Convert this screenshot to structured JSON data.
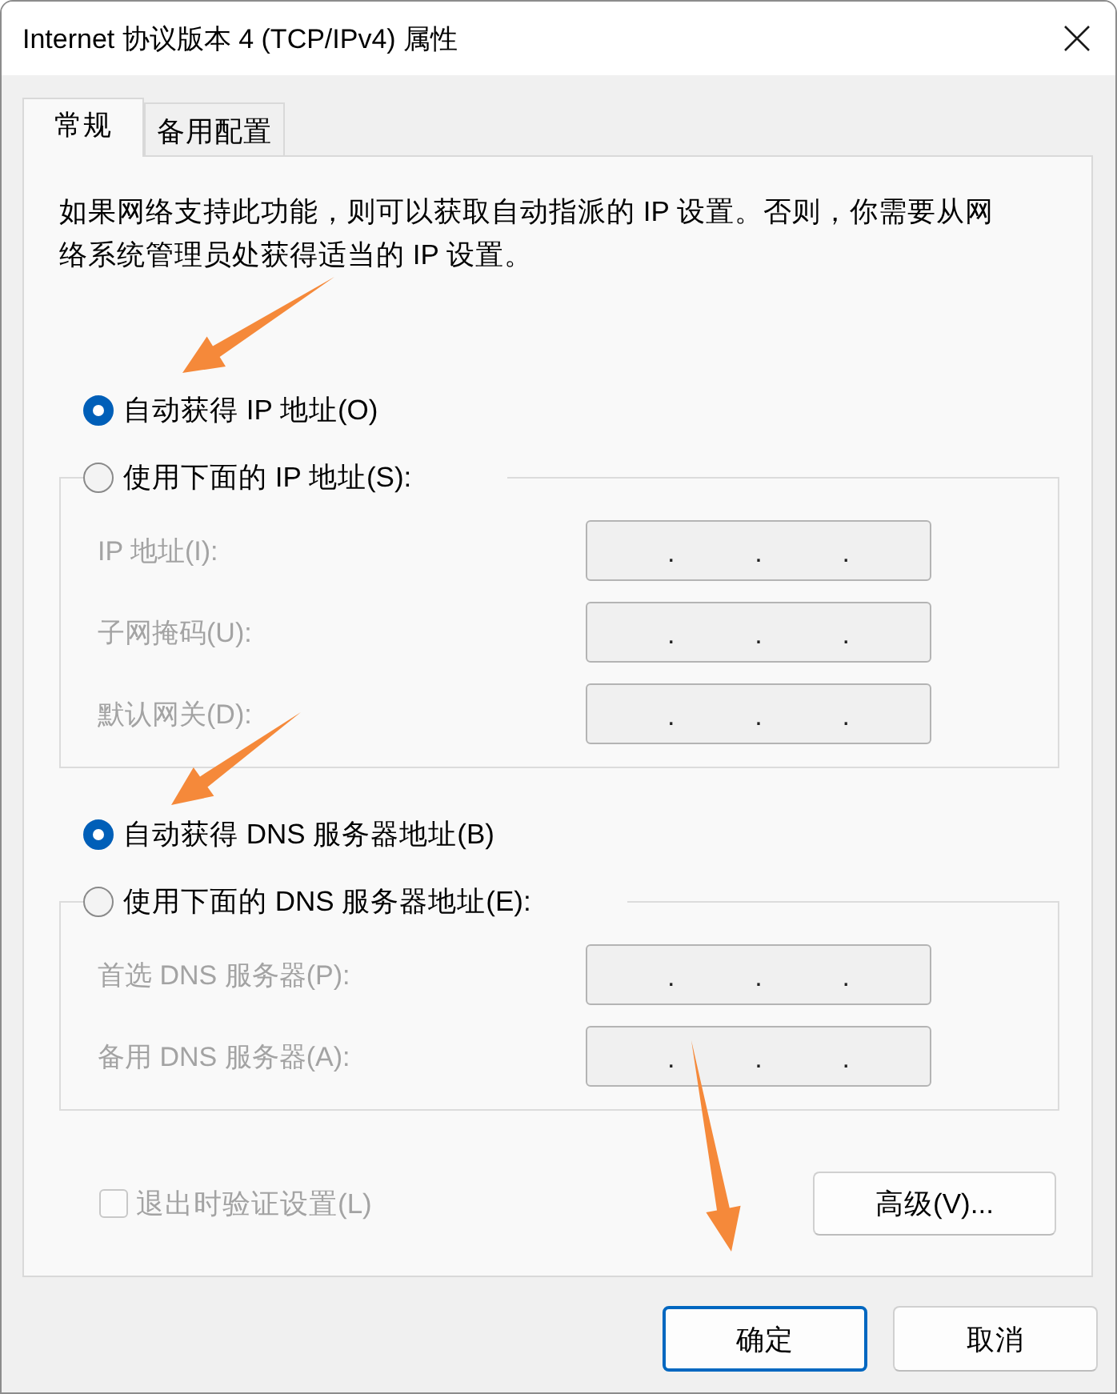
{
  "window": {
    "title": "Internet 协议版本 4 (TCP/IPv4) 属性"
  },
  "tabs": [
    {
      "label": "常规",
      "selected": true
    },
    {
      "label": "备用配置",
      "selected": false
    }
  ],
  "description": "如果网络支持此功能，则可以获取自动指派的 IP 设置。否则，你需要从网络系统管理员处获得适当的 IP 设置。",
  "ip_settings": {
    "options": [
      {
        "label": "自动获得 IP 地址(O)",
        "selected": true
      },
      {
        "label": "使用下面的 IP 地址(S):",
        "selected": false
      }
    ],
    "fields": [
      {
        "label": "IP 地址(I):",
        "disabled": true,
        "separators": [
          ".",
          ".",
          "."
        ]
      },
      {
        "label": "子网掩码(U):",
        "disabled": true,
        "separators": [
          ".",
          ".",
          "."
        ]
      },
      {
        "label": "默认网关(D):",
        "disabled": true,
        "separators": [
          ".",
          ".",
          "."
        ]
      }
    ]
  },
  "dns_settings": {
    "options": [
      {
        "label": "自动获得 DNS 服务器地址(B)",
        "selected": true
      },
      {
        "label": "使用下面的 DNS 服务器地址(E):",
        "selected": false
      }
    ],
    "fields": [
      {
        "label": "首选 DNS 服务器(P):",
        "disabled": true,
        "separators": [
          ".",
          ".",
          "."
        ]
      },
      {
        "label": "备用 DNS 服务器(A):",
        "disabled": true,
        "separators": [
          ".",
          ".",
          "."
        ]
      }
    ]
  },
  "validate_on_exit": {
    "label": "退出时验证设置(L)",
    "checked": false,
    "disabled": true
  },
  "advanced_button": {
    "label": "高级(V)..."
  },
  "buttons": [
    {
      "label": "确定",
      "default": true
    },
    {
      "label": "取消",
      "default": false
    }
  ]
}
